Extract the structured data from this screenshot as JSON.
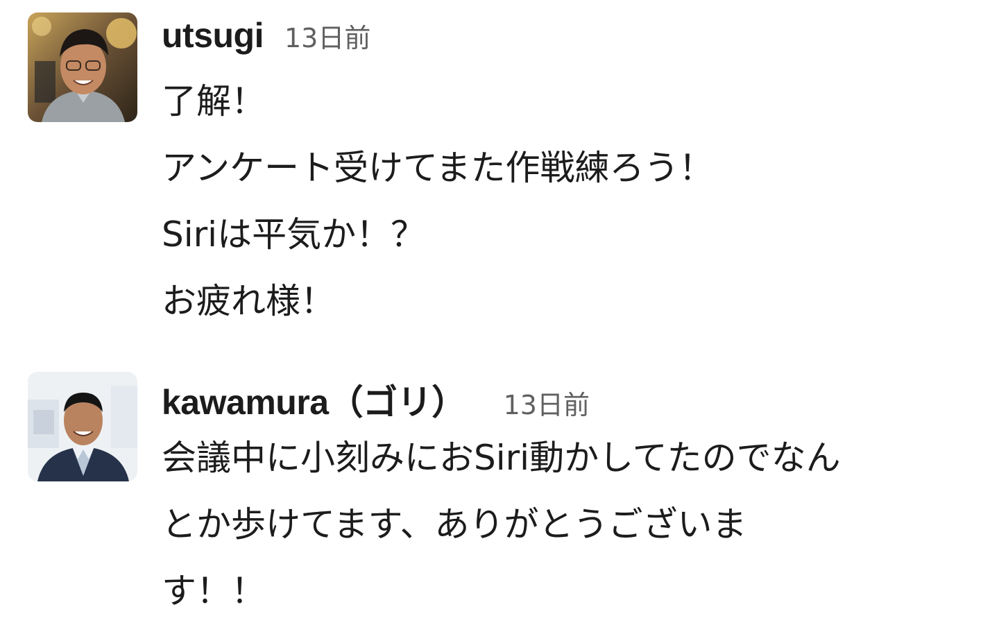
{
  "messages": [
    {
      "username": "utsugi",
      "timestamp": "13日前",
      "avatar_icon": "user-photo-avatar",
      "lines": [
        "了解！",
        "アンケート受けてまた作戦練ろう！",
        "Siriは平気か！？",
        "お疲れ様！"
      ]
    },
    {
      "username": "kawamura（ゴリ）",
      "timestamp": "13日前",
      "avatar_icon": "user-photo-avatar",
      "lines": [
        "会議中に小刻みにおSiri動かしてたのでなん",
        "とか歩けてます、ありがとうございま",
        "す！！"
      ]
    }
  ]
}
